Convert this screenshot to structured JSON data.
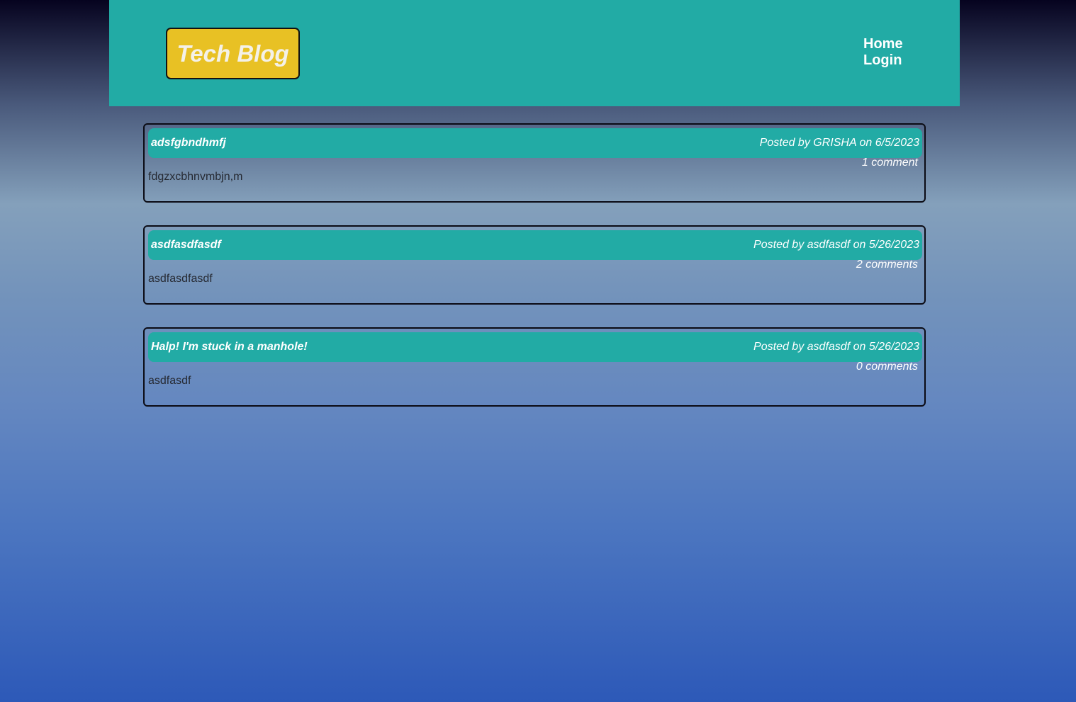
{
  "header": {
    "logo_text": "Tech Blog",
    "nav": {
      "home": "Home",
      "login": "Login"
    }
  },
  "posts": [
    {
      "title": "adsfgbndhmfj",
      "meta": "Posted by GRISHA on 6/5/2023",
      "comments": "1 comment",
      "body": "fdgzxcbhnvmbjn,m"
    },
    {
      "title": "asdfasdfasdf",
      "meta": "Posted by asdfasdf on 5/26/2023",
      "comments": "2 comments",
      "body": "asdfasdfasdf"
    },
    {
      "title": "Halp! I'm stuck in a manhole!",
      "meta": "Posted by asdfasdf on 5/26/2023",
      "comments": "0 comments",
      "body": "asdfasdf"
    }
  ],
  "colors": {
    "header_bg": "#22aba5",
    "logo_bg": "#e8c124",
    "post_bar_bg": "#22aba5",
    "text_light": "#ffffff"
  }
}
